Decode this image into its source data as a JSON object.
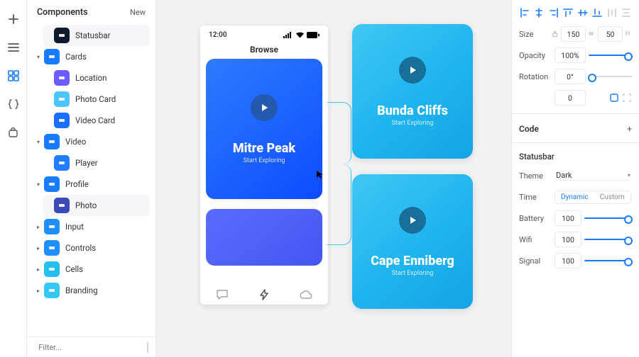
{
  "sidebar": {
    "title": "Components",
    "new_label": "New",
    "filter_placeholder": "Filter...",
    "items": [
      {
        "label": "Statusbar",
        "icon_bg": "#0f1b2d",
        "icon_fg": "#ffffff",
        "leaf": true,
        "selected": true,
        "indent": 1
      },
      {
        "label": "Cards",
        "icon_bg": "#177cff",
        "icon_fg": "#ffffff",
        "header": true
      },
      {
        "label": "Location",
        "icon_bg": "#6b5cff",
        "icon_fg": "#ffffff",
        "leaf": true,
        "indent": 1
      },
      {
        "label": "Photo Card",
        "icon_bg": "#4cc4ff",
        "icon_fg": "#ffffff",
        "leaf": true,
        "indent": 1
      },
      {
        "label": "Video Card",
        "icon_bg": "#1b6dff",
        "icon_fg": "#ffffff",
        "leaf": true,
        "indent": 1
      },
      {
        "label": "Video",
        "icon_bg": "#177cff",
        "icon_fg": "#ffffff",
        "header": true
      },
      {
        "label": "Player",
        "icon_bg": "#1e7eff",
        "icon_fg": "#ffffff",
        "leaf": true,
        "indent": 1
      },
      {
        "label": "Profile",
        "icon_bg": "#177cff",
        "icon_fg": "#ffffff",
        "header": true
      },
      {
        "label": "Photo",
        "icon_bg": "#3b4ab8",
        "icon_fg": "#ffffff",
        "leaf": true,
        "indent": 1,
        "selected": true
      },
      {
        "label": "Input",
        "icon_bg": "#1f8fff",
        "icon_fg": "#ffffff",
        "header": true,
        "collapsed": true
      },
      {
        "label": "Controls",
        "icon_bg": "#1f8fff",
        "icon_fg": "#ffffff",
        "header": true,
        "collapsed": true
      },
      {
        "label": "Cells",
        "icon_bg": "#23bff2",
        "icon_fg": "#ffffff",
        "header": true,
        "collapsed": true
      },
      {
        "label": "Branding",
        "icon_bg": "#35c7f4",
        "icon_fg": "#ffffff",
        "header": true,
        "collapsed": true
      }
    ]
  },
  "canvas": {
    "status_time": "12:00",
    "browse_label": "Browse",
    "card1": {
      "title": "Mitre Peak",
      "sub": "Start Exploring"
    },
    "card_a": {
      "title": "Bunda Cliffs",
      "sub": "Start Exploring"
    },
    "card_b": {
      "title": "Cape Enniberg",
      "sub": "Start Exploring"
    }
  },
  "inspector": {
    "size_label": "Size",
    "width": "150",
    "height": "50",
    "opacity_label": "Opacity",
    "opacity": "100%",
    "rotation_label": "Rotation",
    "rotation": "0°",
    "radius": "0",
    "code_label": "Code",
    "section_title": "Statusbar",
    "theme_label": "Theme",
    "theme_value": "Dark",
    "time_label": "Time",
    "time_dynamic": "Dynamic",
    "time_custom": "Custom",
    "battery_label": "Battery",
    "battery": "100",
    "wifi_label": "Wifi",
    "wifi": "100",
    "signal_label": "Signal",
    "signal": "100"
  }
}
